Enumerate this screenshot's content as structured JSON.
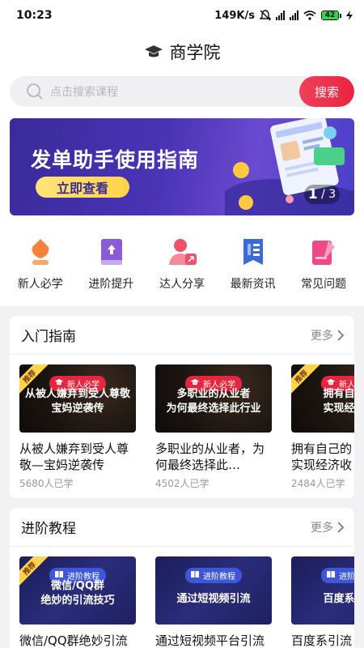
{
  "status": {
    "time": "10:23",
    "speed": "149K/s",
    "battery": "42"
  },
  "header": {
    "title": "商学院"
  },
  "search": {
    "placeholder": "点击搜索课程",
    "button": "搜索"
  },
  "banner": {
    "title": "发单助手使用指南",
    "cta": "立即查看",
    "page_current": "1",
    "page_total": "/ 3"
  },
  "categories": [
    {
      "label": "新人必学",
      "icon": "novice-icon",
      "color": "#f5823a"
    },
    {
      "label": "进阶提升",
      "icon": "book-upgrade-icon",
      "color": "#8a5ad8"
    },
    {
      "label": "达人分享",
      "icon": "expert-share-icon",
      "color": "#f0506a"
    },
    {
      "label": "最新资讯",
      "icon": "news-icon",
      "color": "#3b6bd8"
    },
    {
      "label": "常见问题",
      "icon": "faq-icon",
      "color": "#f04a86"
    }
  ],
  "sections": [
    {
      "title": "入门指南",
      "more": "更多",
      "cards": [
        {
          "badge": "新人必学",
          "ribbon": "推荐",
          "thumb_text": "从被人嫌弃到受人尊敬\n宝妈逆袭传",
          "title": "从被人嫌弃到受人尊敬—宝妈逆袭传",
          "count": "5680人已学"
        },
        {
          "badge": "新人必学",
          "ribbon": "",
          "thumb_text": "多职业的从业者\n为何最终选择此行业",
          "title": "多职业的从业者，为何最终选择此…",
          "count": "4502人已学"
        },
        {
          "badge": "新人必学",
          "ribbon": "推荐",
          "thumb_text": "拥有自己的\n实现经济收",
          "title": "拥有自己的\n实现经济收",
          "count": "2484人已学"
        }
      ]
    },
    {
      "title": "进阶教程",
      "more": "更多",
      "cards": [
        {
          "badge": "进阶教程",
          "ribbon": "推荐",
          "thumb_text": "微信/QQ群\n绝妙的引流技巧",
          "title": "微信/QQ群绝妙引流技巧",
          "count": ""
        },
        {
          "badge": "进阶教程",
          "ribbon": "",
          "thumb_text": "通过短视频引流",
          "title": "通过短视频平台引流",
          "count": ""
        },
        {
          "badge": "进阶教程",
          "ribbon": "",
          "thumb_text": "百度系引流",
          "title": "百度系引流",
          "count": ""
        }
      ]
    }
  ]
}
